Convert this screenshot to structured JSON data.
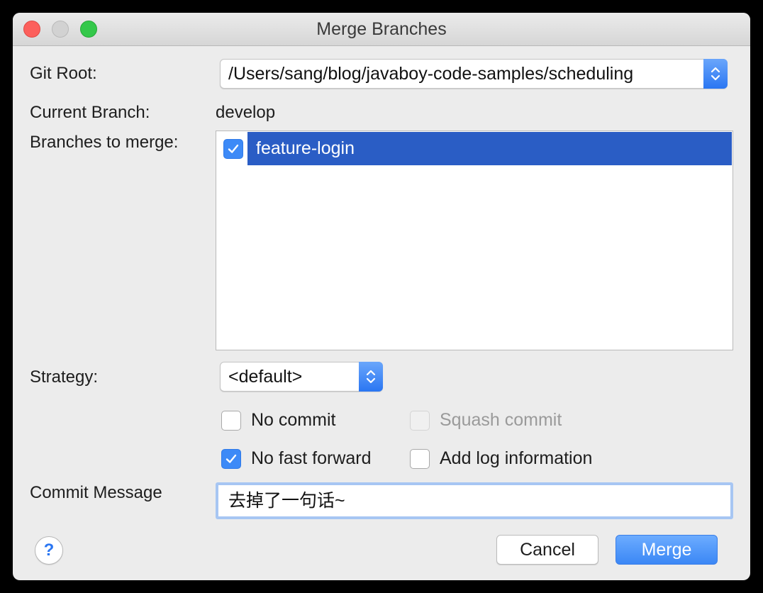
{
  "window": {
    "title": "Merge Branches"
  },
  "git_root": {
    "label": "Git Root:",
    "value": "/Users/sang/blog/javaboy-code-samples/scheduling"
  },
  "current_branch": {
    "label": "Current Branch:",
    "value": "develop"
  },
  "branches": {
    "label": "Branches to merge:",
    "items": [
      {
        "name": "feature-login",
        "checked": true,
        "selected": true
      }
    ]
  },
  "strategy": {
    "label": "Strategy:",
    "value": "<default>"
  },
  "options": {
    "no_commit": {
      "label": "No commit",
      "checked": false,
      "enabled": true
    },
    "squash_commit": {
      "label": "Squash commit",
      "checked": false,
      "enabled": false
    },
    "no_fast_forward": {
      "label": "No fast forward",
      "checked": true,
      "enabled": true
    },
    "add_log_information": {
      "label": "Add log information",
      "checked": false,
      "enabled": true
    }
  },
  "commit_message": {
    "label": "Commit Message",
    "value": "去掉了一句话~"
  },
  "buttons": {
    "help": "?",
    "cancel": "Cancel",
    "merge": "Merge"
  },
  "colors": {
    "accent": "#3d8af7",
    "selection": "#2a5dc5"
  }
}
